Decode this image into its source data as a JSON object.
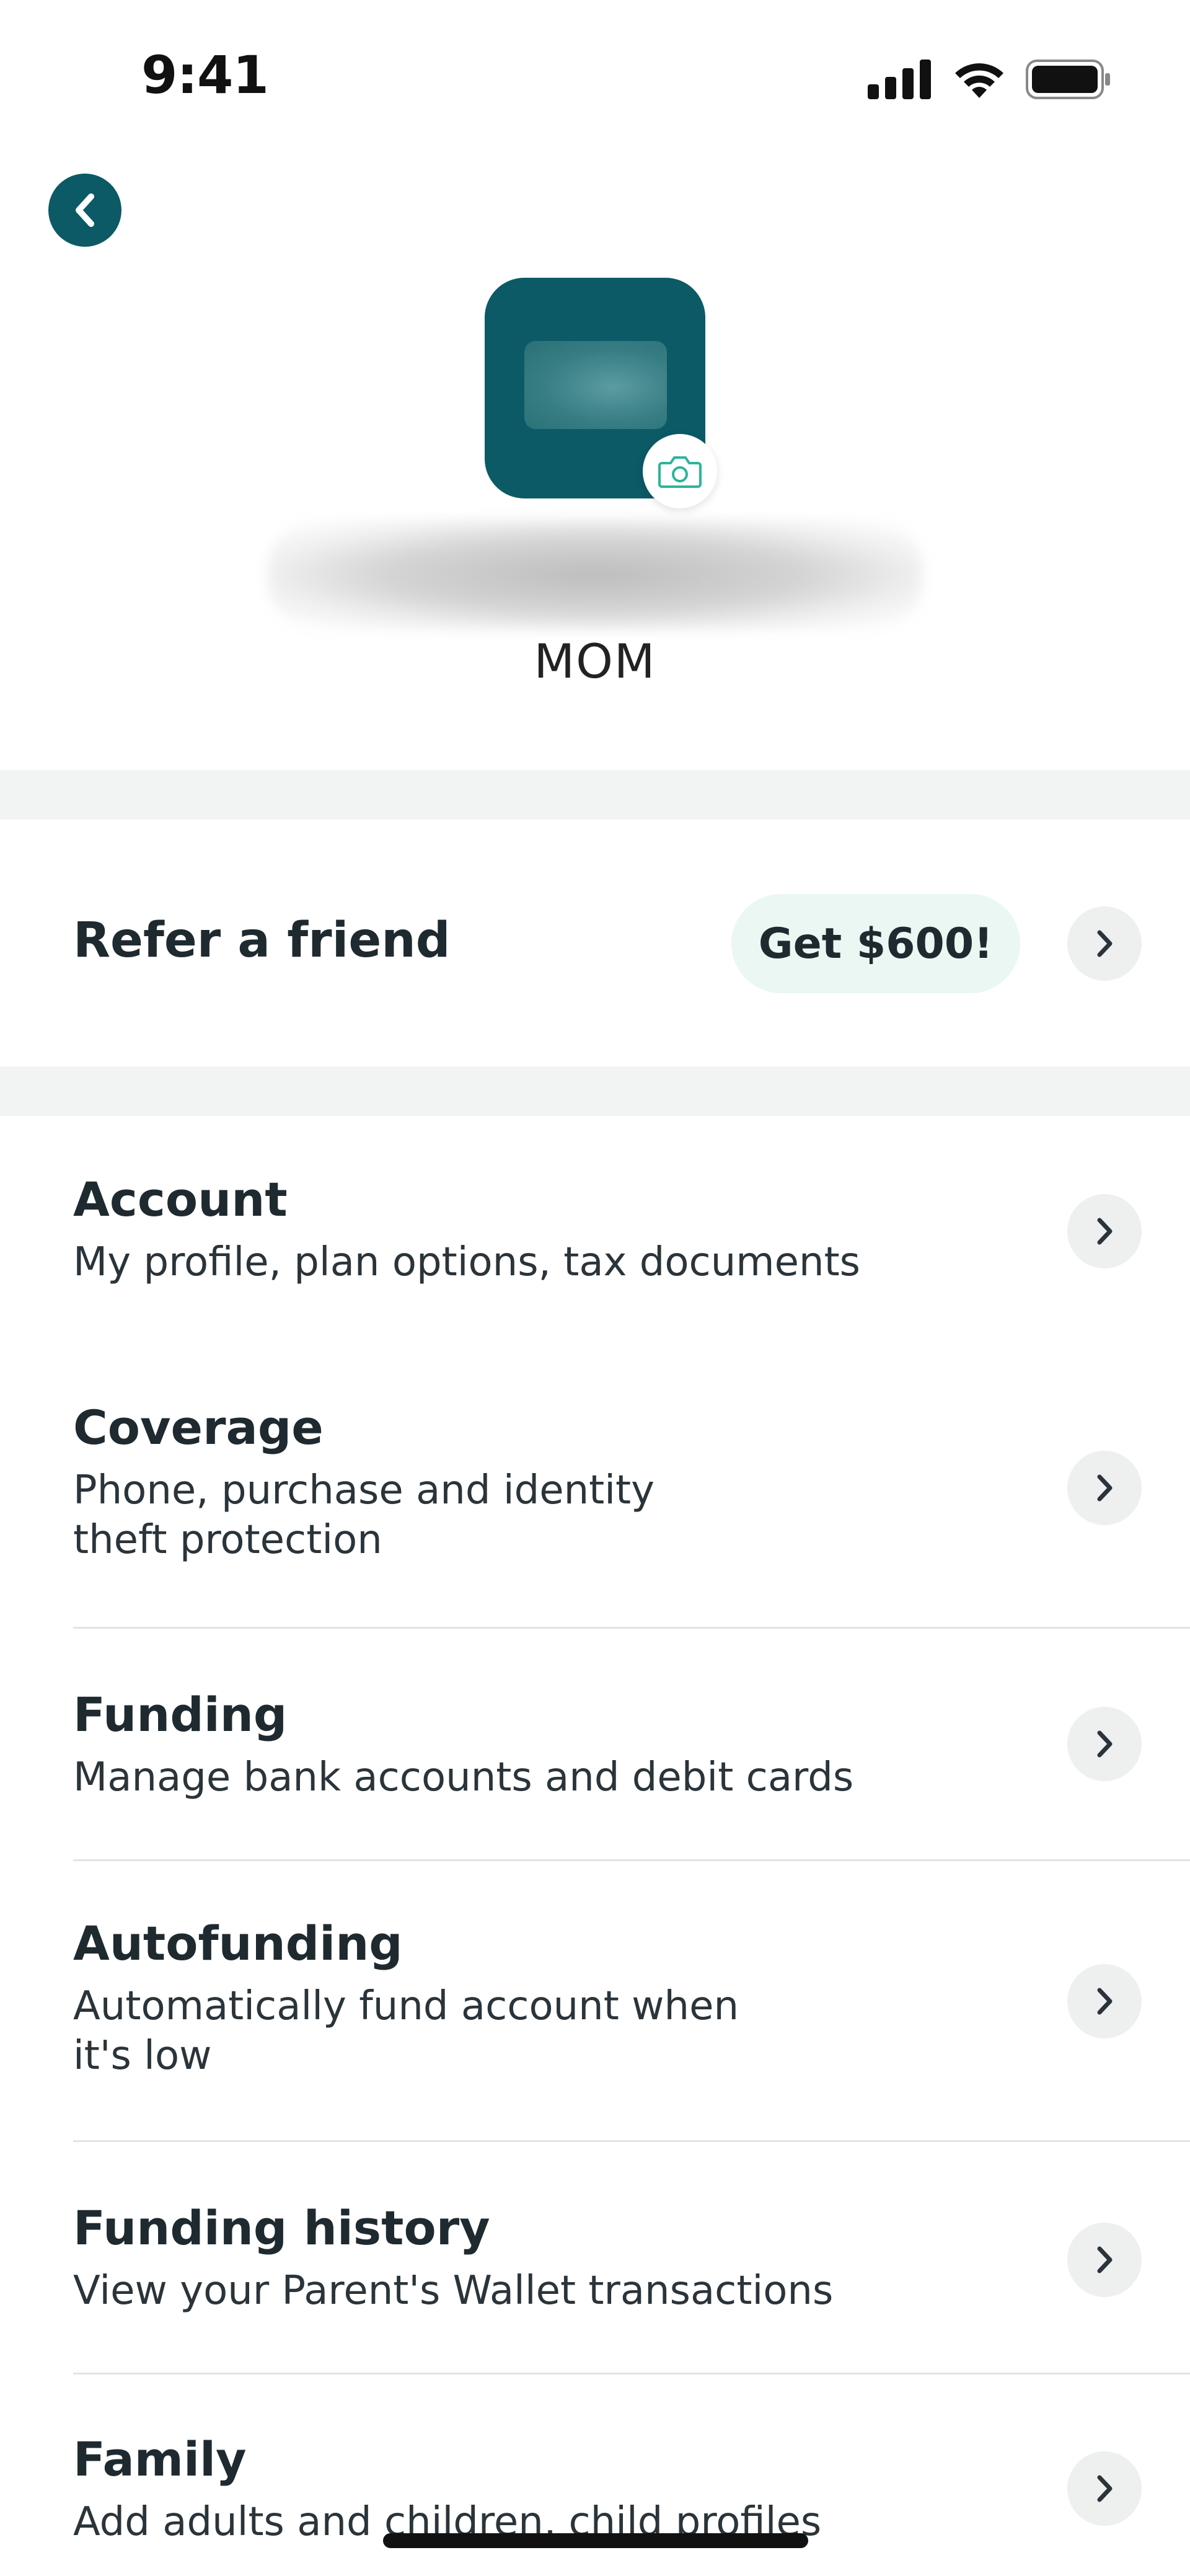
{
  "status": {
    "time": "9:41"
  },
  "profile": {
    "relation": "MOM"
  },
  "refer": {
    "label": "Refer a friend",
    "pill": "Get $600!"
  },
  "menu": [
    {
      "title": "Account",
      "subtitle": "My profile, plan options, tax documents"
    },
    {
      "title": "Coverage",
      "subtitle": "Phone, purchase and identity\ntheft protection"
    },
    {
      "title": "Funding",
      "subtitle": "Manage bank accounts and debit cards"
    },
    {
      "title": "Autofunding",
      "subtitle": "Automatically fund account when\nit's low"
    },
    {
      "title": "Funding history",
      "subtitle": "View your Parent's Wallet transactions"
    },
    {
      "title": "Family",
      "subtitle": "Add adults and children, child profiles"
    }
  ],
  "icons": {
    "back": "chevron-left-icon",
    "camera": "camera-icon",
    "chevron": "chevron-right-icon",
    "signal": "signal-icon",
    "wifi": "wifi-icon",
    "battery": "battery-icon"
  },
  "colors": {
    "brand": "#0b5a66",
    "accent": "#2bb59a",
    "pill_bg": "#eaf7f3",
    "band": "#f2f4f3"
  }
}
